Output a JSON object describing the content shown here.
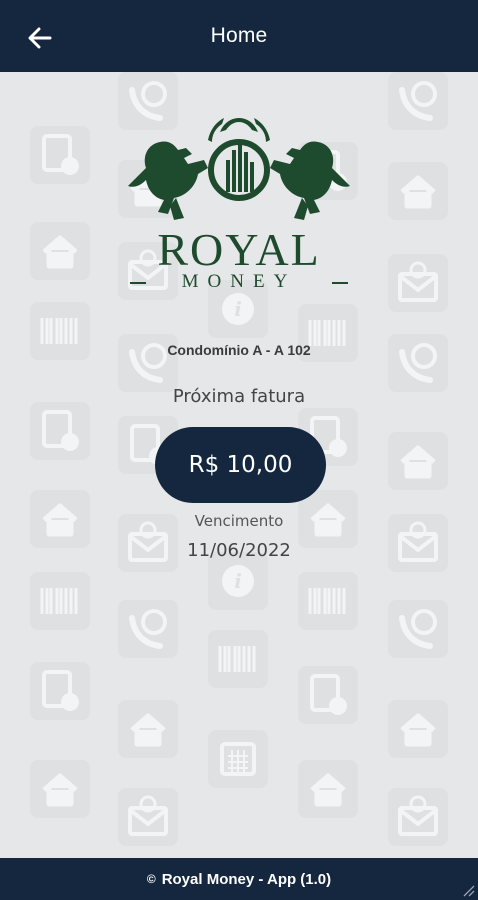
{
  "header": {
    "title": "Home",
    "back_icon": "arrow-left-icon"
  },
  "brand": {
    "name": "ROYAL",
    "tagline": "MONEY",
    "color": "#1e4a2d"
  },
  "account": {
    "unit": "Condomínio A - A 102"
  },
  "invoice": {
    "label": "Próxima fatura",
    "amount": "R$ 10,00",
    "due_label": "Vencimento",
    "due_date": "11/06/2022"
  },
  "footer": {
    "copyright_symbol": "©",
    "text": "Royal Money - App (1.0)"
  },
  "theme": {
    "primary": "#14273f",
    "background": "#e6e7e9"
  }
}
